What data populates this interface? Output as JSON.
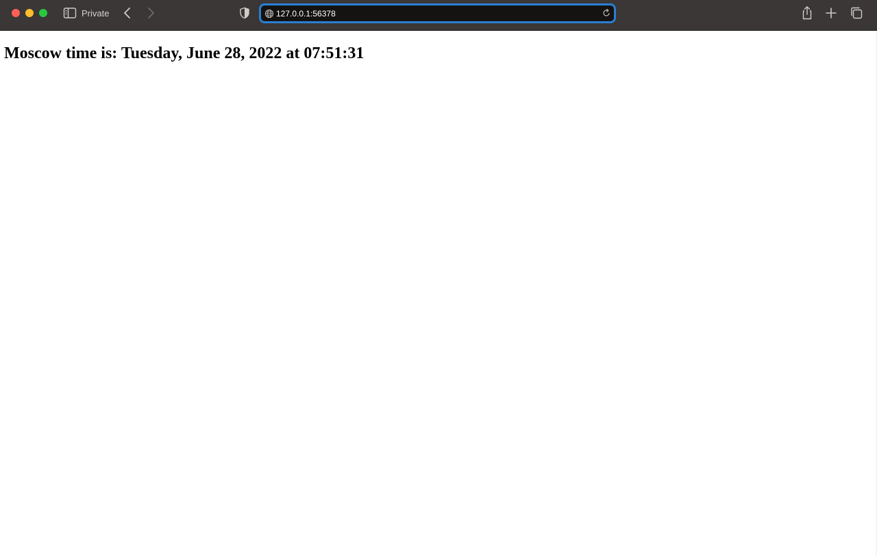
{
  "toolbar": {
    "private_label": "Private",
    "url": "127.0.0.1:56378",
    "icons": {
      "sidebar": "sidebar-icon",
      "back": "chevron-left-icon",
      "forward": "chevron-right-icon",
      "privacy": "shield-icon",
      "site": "globe-icon",
      "reload": "reload-icon",
      "share": "share-icon",
      "new_tab": "plus-icon",
      "tabs": "tabs-overview-icon"
    },
    "colors": {
      "background": "#3a3736",
      "url_focus_ring": "#2b7fd4",
      "url_field": "#141312",
      "close": "#fe5f57",
      "minimize": "#febc2e",
      "maximize": "#28c840"
    }
  },
  "page": {
    "heading": "Moscow time is: Tuesday, June 28, 2022 at 07:51:31"
  }
}
